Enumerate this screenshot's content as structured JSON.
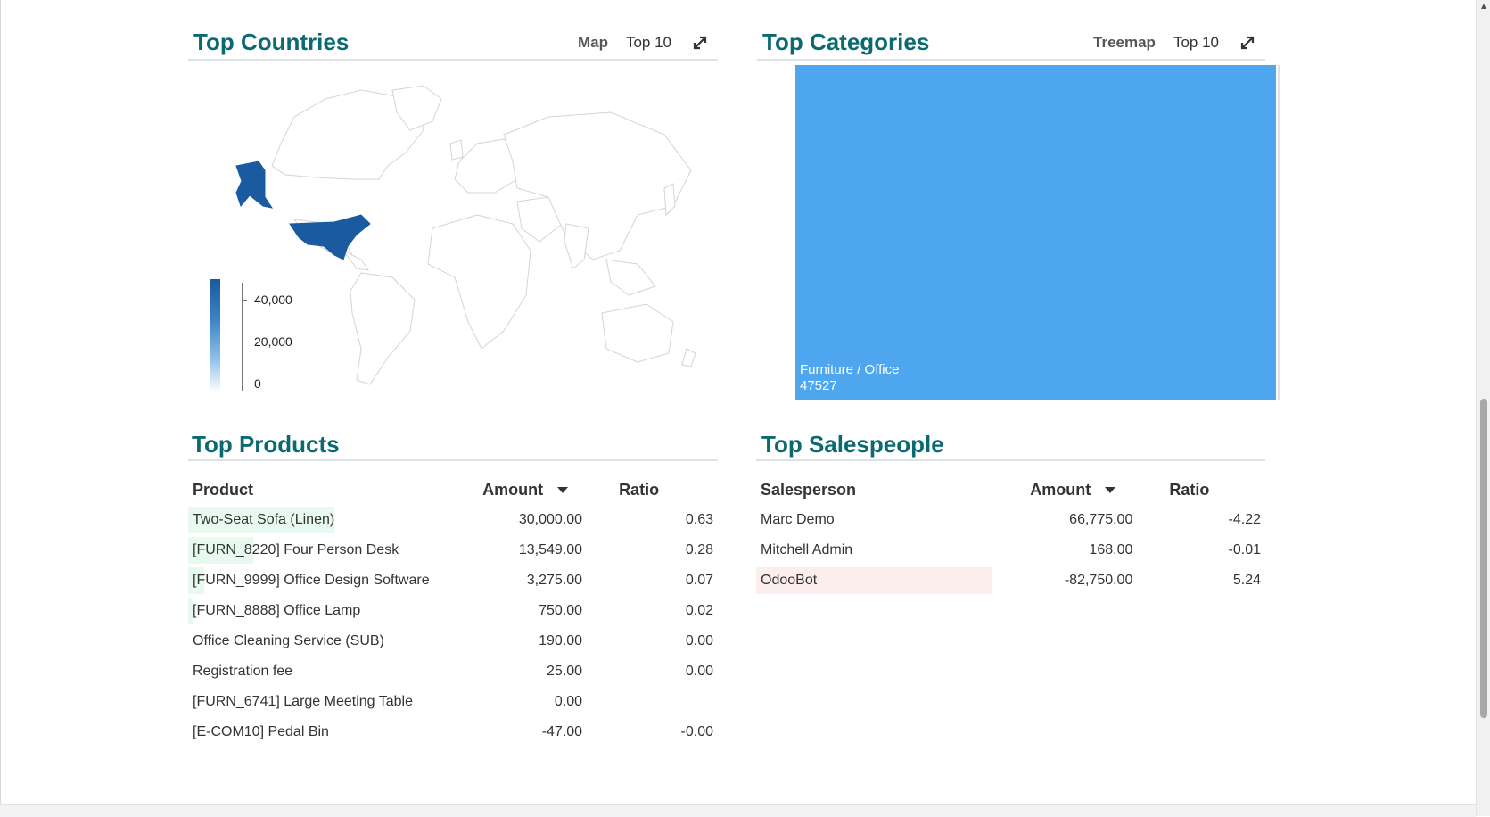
{
  "colors": {
    "title": "#0b6a71",
    "map_fill": "#1a5aa0",
    "treemap_fill": "#4da6ee",
    "positive_bar": "#e8faf0",
    "negative_bar": "#fdeeee"
  },
  "countries": {
    "title": "Top Countries",
    "view_mode": "Map",
    "limit": "Top 10",
    "expand_icon": "expand-arrows-icon",
    "legend": {
      "ticks": [
        "40,000",
        "20,000",
        "0"
      ],
      "scale_max": 47527
    },
    "highlighted": [
      "United States"
    ]
  },
  "categories": {
    "title": "Top Categories",
    "view_mode": "Treemap",
    "limit": "Top 10",
    "expand_icon": "expand-arrows-icon",
    "cells": [
      {
        "label": "Furniture / Office",
        "value": "47527"
      }
    ]
  },
  "products": {
    "title": "Top Products",
    "headers": {
      "name": "Product",
      "amount": "Amount",
      "ratio": "Ratio"
    },
    "rows": [
      {
        "name": "Two-Seat Sofa (Linen)",
        "amount": "30,000.00",
        "ratio": "0.63",
        "share": 0.63,
        "sign": "pos"
      },
      {
        "name": "[FURN_8220] Four Person Desk",
        "amount": "13,549.00",
        "ratio": "0.28",
        "share": 0.28,
        "sign": "pos"
      },
      {
        "name": "[FURN_9999] Office Design Software",
        "amount": "3,275.00",
        "ratio": "0.07",
        "share": 0.07,
        "sign": "pos"
      },
      {
        "name": "[FURN_8888] Office Lamp",
        "amount": "750.00",
        "ratio": "0.02",
        "share": 0.02,
        "sign": "pos"
      },
      {
        "name": "Office Cleaning Service (SUB)",
        "amount": "190.00",
        "ratio": "0.00",
        "share": 0,
        "sign": "pos"
      },
      {
        "name": "Registration fee",
        "amount": "25.00",
        "ratio": "0.00",
        "share": 0,
        "sign": "pos"
      },
      {
        "name": "[FURN_6741] Large Meeting Table",
        "amount": "0.00",
        "ratio": "",
        "share": 0,
        "sign": "pos"
      },
      {
        "name": "[E-COM10] Pedal Bin",
        "amount": "-47.00",
        "ratio": "-0.00",
        "share": 0,
        "sign": "neg"
      }
    ]
  },
  "salespeople": {
    "title": "Top Salespeople",
    "headers": {
      "name": "Salesperson",
      "amount": "Amount",
      "ratio": "Ratio"
    },
    "rows": [
      {
        "name": "Marc Demo",
        "amount": "66,775.00",
        "ratio": "-4.22",
        "share": 0,
        "sign": "pos"
      },
      {
        "name": "Mitchell Admin",
        "amount": "168.00",
        "ratio": "-0.01",
        "share": 0,
        "sign": "pos"
      },
      {
        "name": "OdooBot",
        "amount": "-82,750.00",
        "ratio": "5.24",
        "share": 1,
        "sign": "neg"
      }
    ]
  }
}
